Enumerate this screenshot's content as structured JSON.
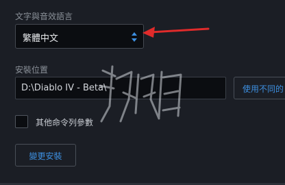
{
  "settings": {
    "language_label": "文字與音效語言",
    "language_value": "繁體中文",
    "install_location_label": "安裝位置",
    "install_path": "D:\\Diablo IV - Beta\\",
    "browse_button_label": "使用不同的",
    "extra_args_label": "其他命令列參數",
    "extra_args_checked": false,
    "change_install_button_label": "變更安裝"
  },
  "colors": {
    "background": "#1b1e25",
    "field_background": "#0b0d11",
    "accent_blue": "#3d8fe0",
    "annotation_red": "#e02b2b"
  },
  "icons": {
    "dropdown": "chevron-up-down-icon",
    "annotation": "red-arrow-icon",
    "watermark": "watermark-logo"
  }
}
